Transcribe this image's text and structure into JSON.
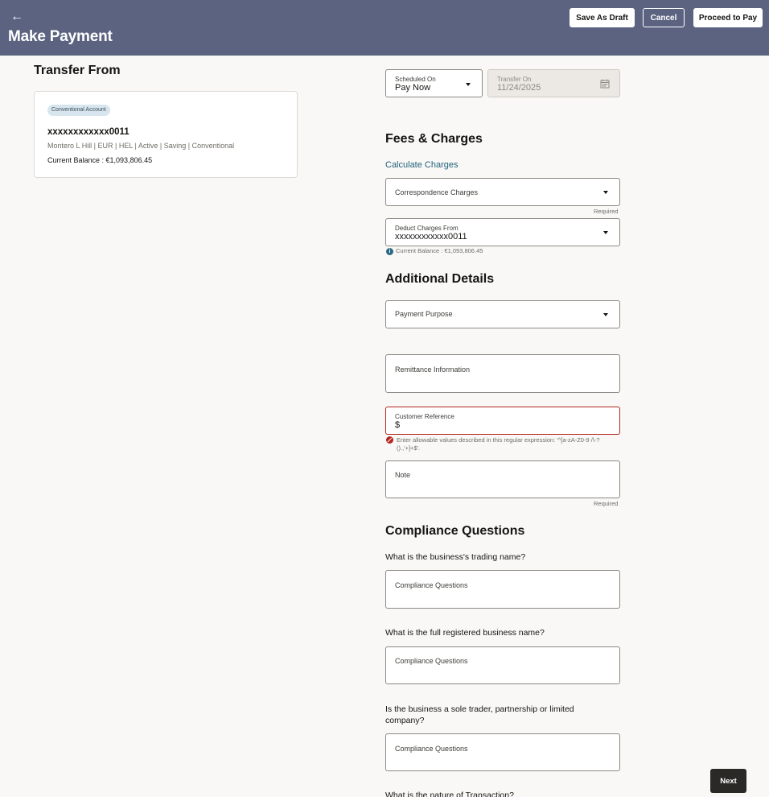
{
  "header": {
    "back_icon": "arrow-left-icon",
    "title": "Make Payment",
    "save_draft": "Save As Draft",
    "cancel": "Cancel",
    "proceed": "Proceed to Pay",
    "bg_color": "#5b6381"
  },
  "transfer_from": {
    "title": "Transfer From",
    "badge": "Conventional Account",
    "account_number": "xxxxxxxxxxxx0011",
    "account_meta": "Montero L Hill | EUR | HEL | Active | Saving | Conventional",
    "balance": "Current Balance : €1,093,806.45"
  },
  "schedule": {
    "scheduled_on_label": "Scheduled On",
    "scheduled_on_value": "Pay Now",
    "transfer_on_label": "Transfer On",
    "transfer_on_value": "11/24/2025",
    "calendar_icon": "calendar-icon"
  },
  "fees": {
    "title": "Fees & Charges",
    "calculate_link": "Calculate Charges",
    "correspondence_label": "Correspondence Charges",
    "correspondence_required": "Required",
    "deduct_label": "Deduct Charges From",
    "deduct_value": "xxxxxxxxxxxx0011",
    "deduct_balance": "Current Balance : €1,093,806.45"
  },
  "additional": {
    "title": "Additional Details",
    "payment_purpose_label": "Payment Purpose",
    "remittance_label": "Remittance Information",
    "customer_ref_label": "Customer Reference",
    "customer_ref_value": "$",
    "customer_ref_error_line1": "Enter allowable values described in this regular expression: '^[a-zA-Z0-9 /\\-?",
    "customer_ref_error_line2": "().,'+]+$'.",
    "note_label": "Note",
    "note_required": "Required"
  },
  "compliance": {
    "title": "Compliance Questions",
    "q1": "What is the business's trading name?",
    "q1_label": "Compliance Questions",
    "q2": "What is the full registered business name?",
    "q2_label": "Compliance Questions",
    "q3_line1": "Is the business a sole trader, partnership or limited",
    "q3_line2": "company?",
    "q3_label": "Compliance Questions",
    "q4": "What is the nature of Transaction?"
  },
  "footer": {
    "next": "Next"
  }
}
